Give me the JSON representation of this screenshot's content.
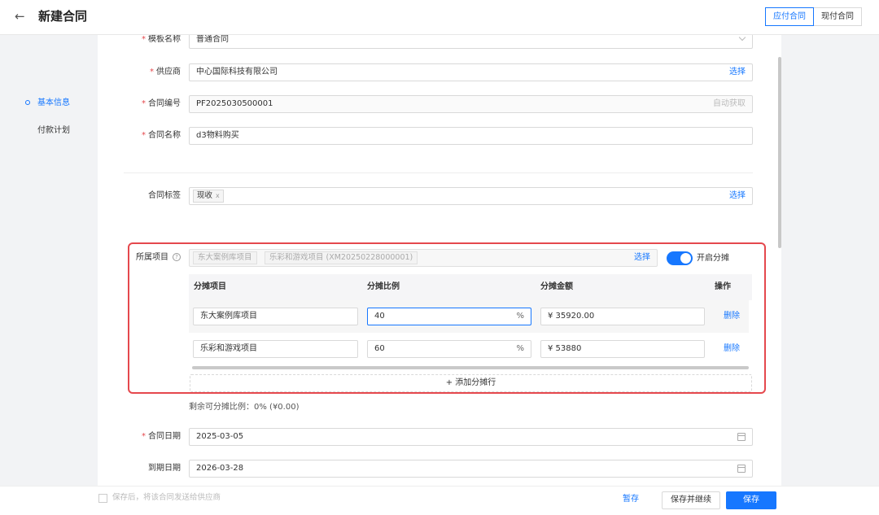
{
  "header": {
    "back_icon": "arrow-left-icon",
    "back_glyph": "←",
    "title": "新建合同",
    "tabs": [
      {
        "label": "应付合同",
        "active": true
      },
      {
        "label": "现付合同",
        "active": false
      }
    ]
  },
  "sidenav": {
    "items": [
      {
        "label": "基本信息",
        "active": true
      },
      {
        "label": "付款计划",
        "active": false
      }
    ]
  },
  "form": {
    "template": {
      "label": "模板名称",
      "value": "普通合同",
      "required": "*"
    },
    "supplier": {
      "label": "供应商",
      "value": "中心国际科技有限公司",
      "action": "选择",
      "required": "*"
    },
    "contract_no": {
      "label": "合同编号",
      "value": "PF2025030500001",
      "hint": "自动获取",
      "required": "*"
    },
    "contract_name": {
      "label": "合同名称",
      "value": "d3物料购买",
      "required": "*"
    },
    "tags": {
      "label": "合同标签",
      "tag": "现收",
      "tag_remove": "x",
      "action": "选择"
    },
    "projects": {
      "label": "所属项目",
      "help_glyph": "?",
      "chips": [
        "东大案例库项目",
        "乐彩和游戏项目 (XM20250228000001)"
      ],
      "action": "选择",
      "toggle_label": "开启分摊",
      "toggle_on": true
    },
    "allocation": {
      "columns": [
        "分摊项目",
        "分摊比例",
        "分摊金额",
        "操作"
      ],
      "rows": [
        {
          "project": "东大案例库项目",
          "ratio": "40",
          "unit": "%",
          "amount": "¥  35920.00",
          "action": "删除"
        },
        {
          "project": "乐彩和游戏项目",
          "ratio": "60",
          "unit": "%",
          "amount": "¥  53880",
          "action": "删除"
        }
      ],
      "add_row": "+ 添加分摊行",
      "remaining": "剩余可分摊比例：0% (¥0.00)"
    },
    "contract_date": {
      "label": "合同日期",
      "value": "2025-03-05",
      "required": "*"
    },
    "expiry_date": {
      "label": "到期日期",
      "value": "2026-03-28"
    }
  },
  "footer": {
    "checkbox_label": "保存后，将该合同发送给供应商",
    "draft": "暂存",
    "save_continue": "保存并继续",
    "save": "保存"
  },
  "colors": {
    "accent": "#1677ff",
    "highlight_box": "#e5484d",
    "required": "#e5484d"
  }
}
